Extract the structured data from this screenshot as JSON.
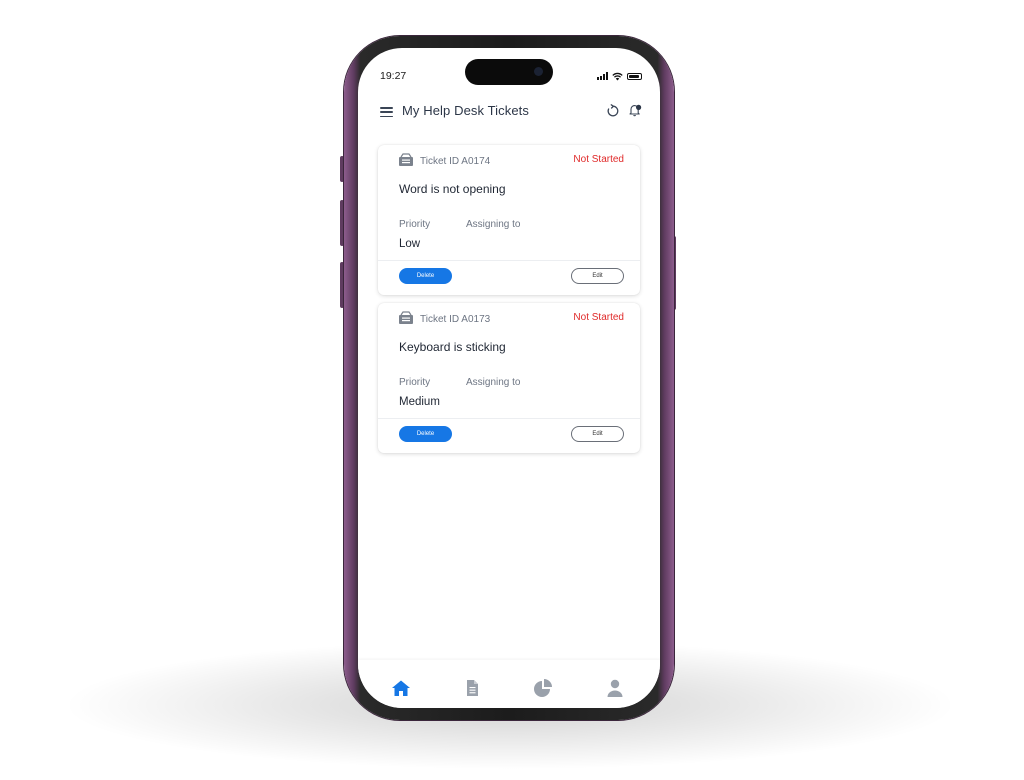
{
  "status_bar": {
    "time": "19:27"
  },
  "app_bar": {
    "title": "My Help Desk Tickets",
    "menu_icon": "hamburger-menu-icon",
    "refresh_icon": "refresh-icon",
    "notifications_icon": "bell-icon"
  },
  "tickets": [
    {
      "id_label": "Ticket ID A0174",
      "status": "Not Started",
      "subject": "Word is not opening",
      "priority_label": "Priority",
      "assign_label": "Assigning to",
      "priority_value": "Low",
      "delete_label": "Delete",
      "edit_label": "Edit"
    },
    {
      "id_label": "Ticket ID A0173",
      "status": "Not Started",
      "subject": "Keyboard is sticking",
      "priority_label": "Priority",
      "assign_label": "Assigning to",
      "priority_value": "Medium",
      "delete_label": "Delete",
      "edit_label": "Edit"
    }
  ],
  "bottom_nav": {
    "items": [
      "home-icon",
      "document-icon",
      "pie-chart-icon",
      "profile-icon"
    ],
    "active": "home-icon"
  },
  "colors": {
    "accent": "#1677e5",
    "status_red": "#e02a2a",
    "nav_inactive": "#9aa1ab",
    "text_dark": "#1f2633"
  }
}
